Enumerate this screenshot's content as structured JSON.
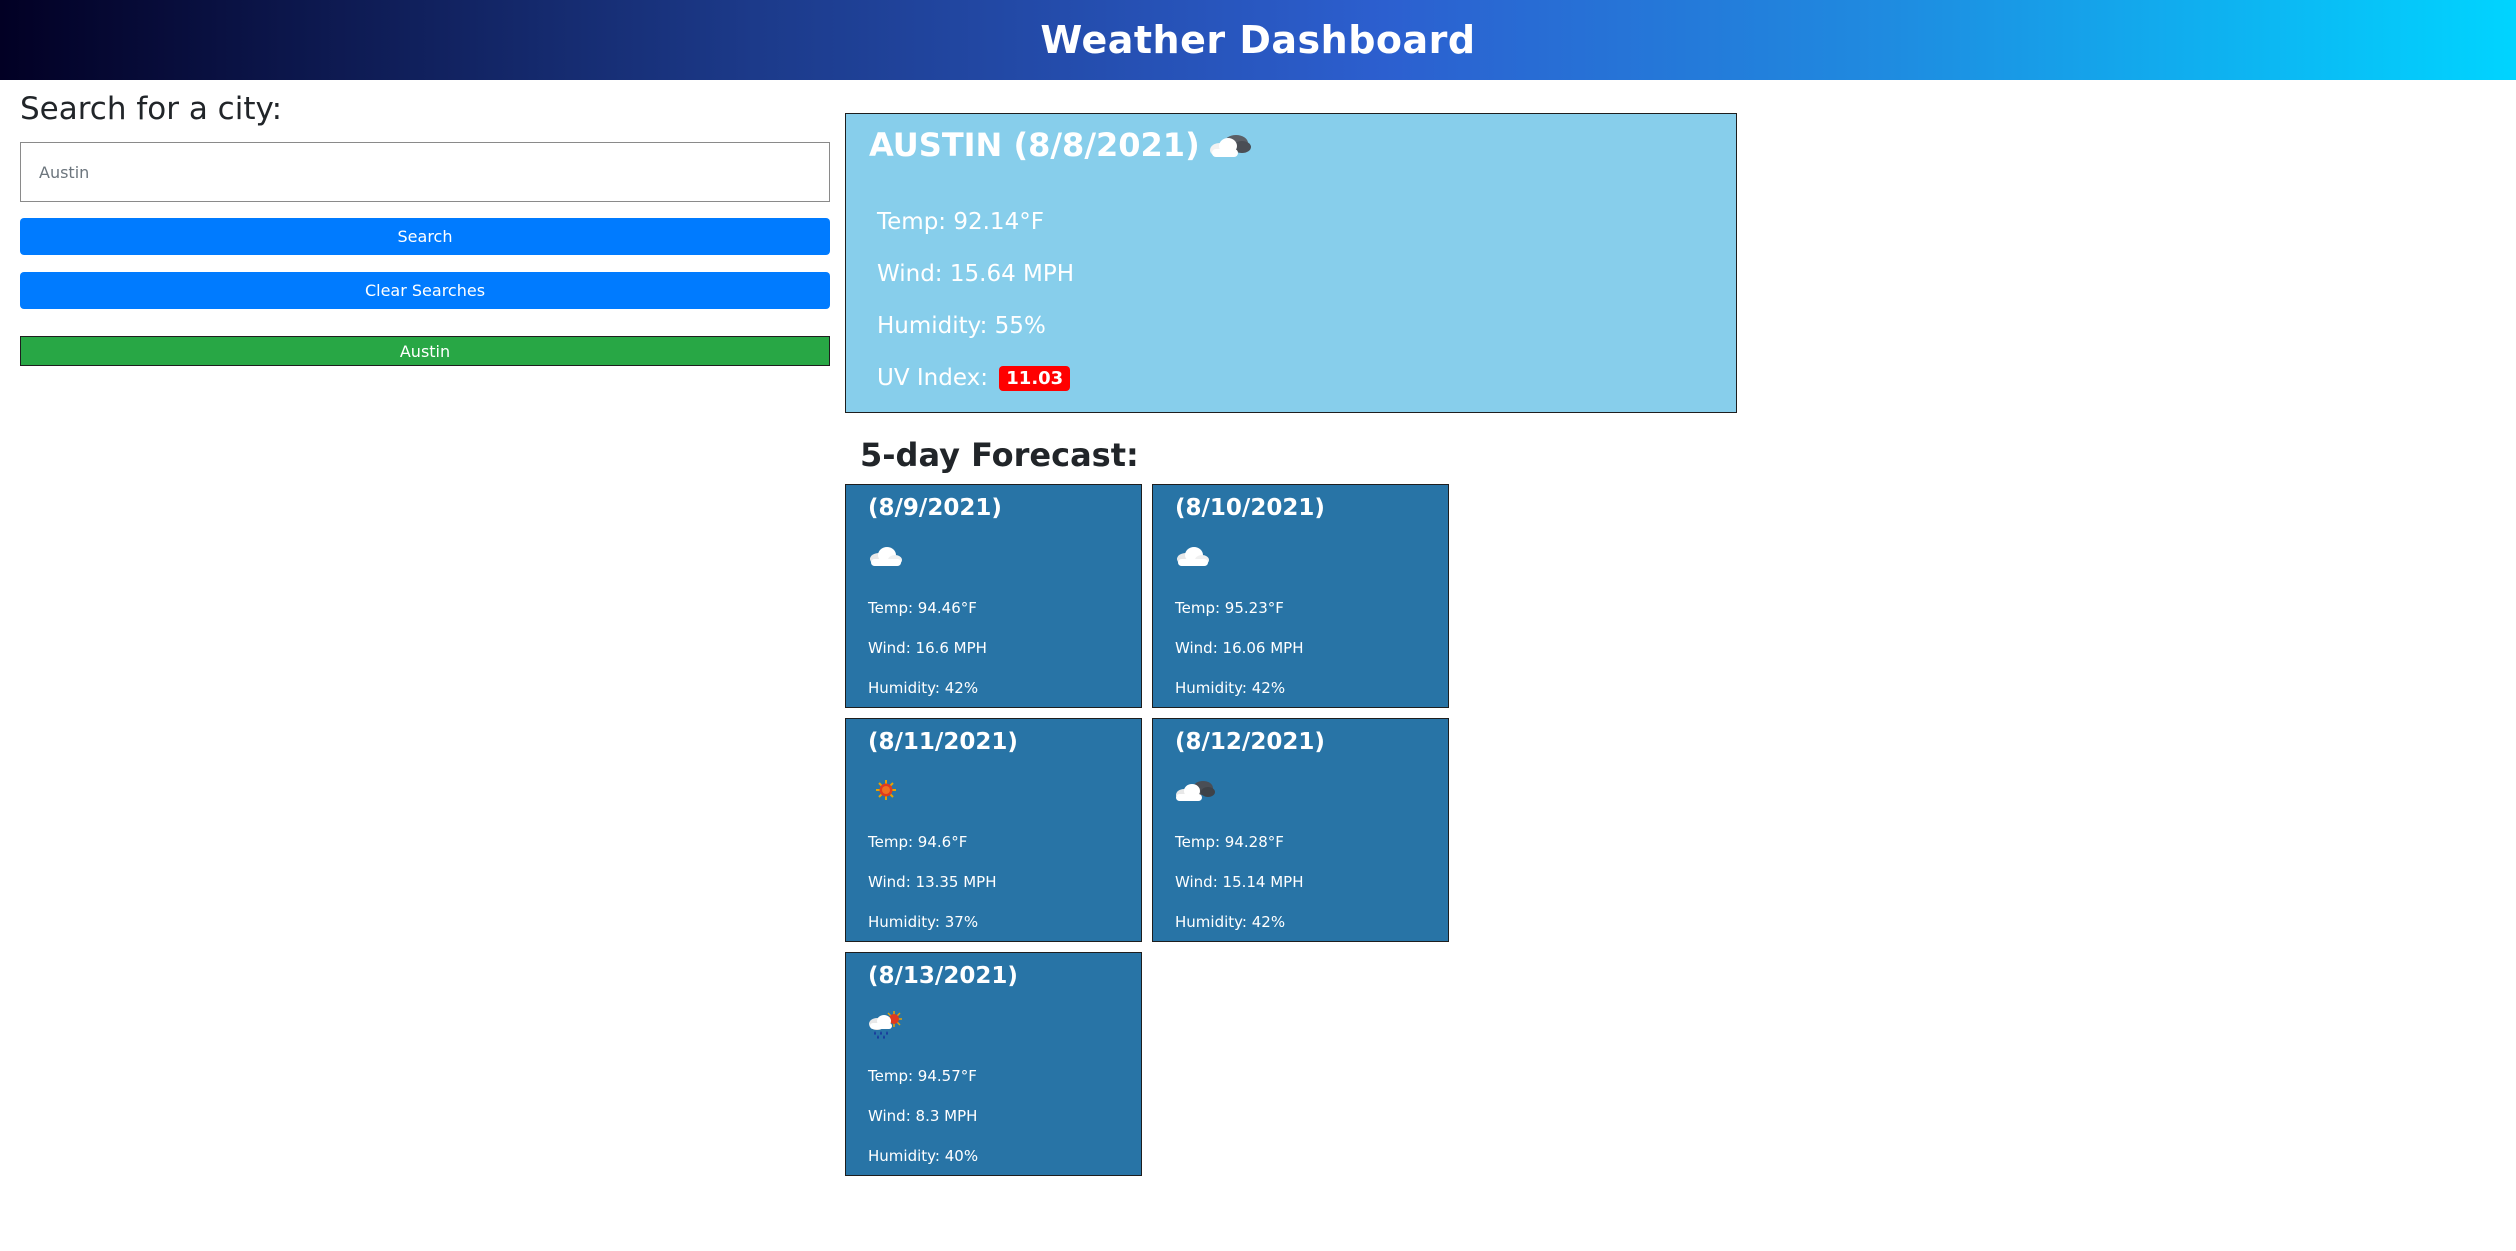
{
  "header": {
    "title": "Weather Dashboard"
  },
  "search": {
    "title": "Search for a city:",
    "input_value": "",
    "input_placeholder": "Austin",
    "search_label": "Search",
    "clear_label": "Clear Searches",
    "history": [
      "Austin"
    ]
  },
  "current": {
    "title": "AUSTIN (8/8/2021)",
    "icon": "cloud-dark-icon",
    "temp": "Temp: 92.14°F",
    "wind": "Wind: 15.64 MPH",
    "humidity": "Humidity: 55%",
    "uv_label": "UV Index:",
    "uv_value": "11.03",
    "uv_color": "#ff0000"
  },
  "forecast": {
    "title": "5-day Forecast:",
    "days": [
      {
        "date": "(8/9/2021)",
        "icon": "cloud-icon",
        "temp": "Temp: 94.46°F",
        "wind": "Wind: 16.6 MPH",
        "humidity": "Humidity: 42%"
      },
      {
        "date": "(8/10/2021)",
        "icon": "cloud-icon",
        "temp": "Temp: 95.23°F",
        "wind": "Wind: 16.06 MPH",
        "humidity": "Humidity: 42%"
      },
      {
        "date": "(8/11/2021)",
        "icon": "sun-icon",
        "temp": "Temp: 94.6°F",
        "wind": "Wind: 13.35 MPH",
        "humidity": "Humidity: 37%"
      },
      {
        "date": "(8/12/2021)",
        "icon": "broken-clouds-icon",
        "temp": "Temp: 94.28°F",
        "wind": "Wind: 15.14 MPH",
        "humidity": "Humidity: 42%"
      },
      {
        "date": "(8/13/2021)",
        "icon": "sun-rain-icon",
        "temp": "Temp: 94.57°F",
        "wind": "Wind: 8.3 MPH",
        "humidity": "Humidity: 40%"
      }
    ]
  },
  "colors": {
    "primary_button": "#007bff",
    "history_button": "#28a745",
    "current_card": "#87ceeb",
    "forecast_card": "#2874a6"
  }
}
